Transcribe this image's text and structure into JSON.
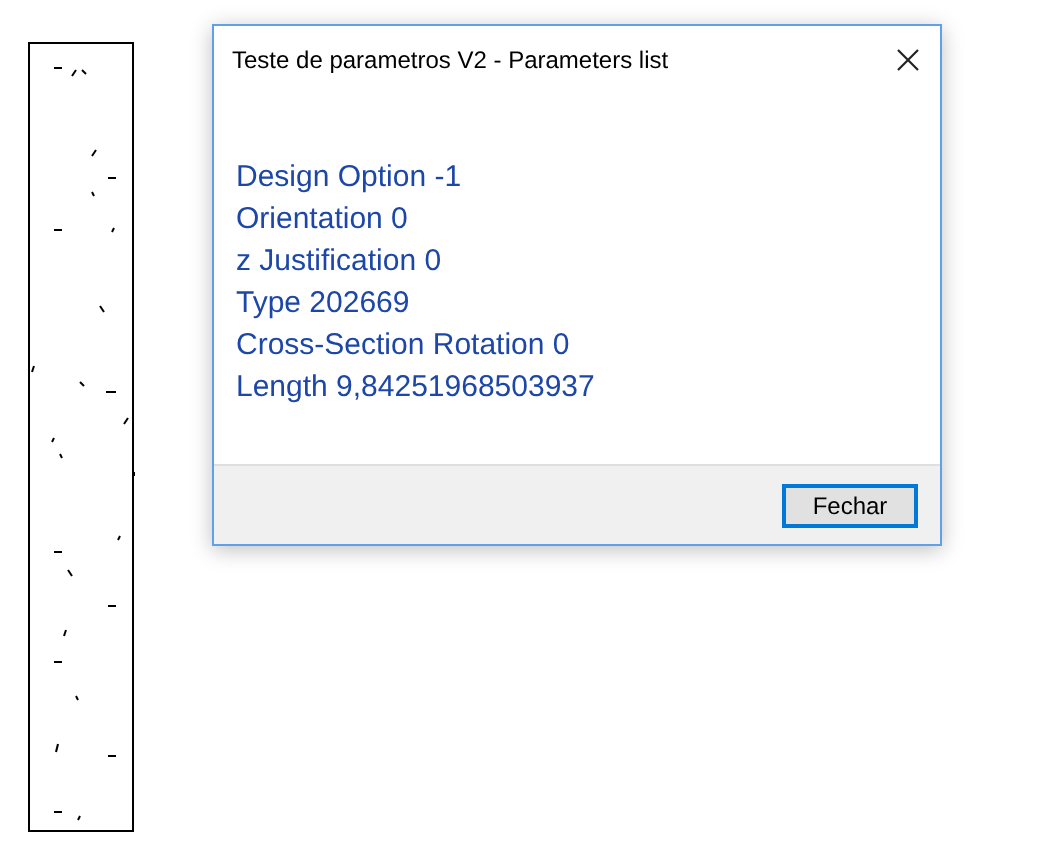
{
  "window": {
    "title": "Teste de parametros V2 - Parameters list"
  },
  "parameters": [
    "Design Option -1",
    "Orientation 0",
    "z Justification 0",
    "Type 202669",
    "Cross-Section Rotation 0",
    "Length 9,84251968503937"
  ],
  "buttons": [
    {
      "label": "Fechar",
      "focused": true
    }
  ]
}
